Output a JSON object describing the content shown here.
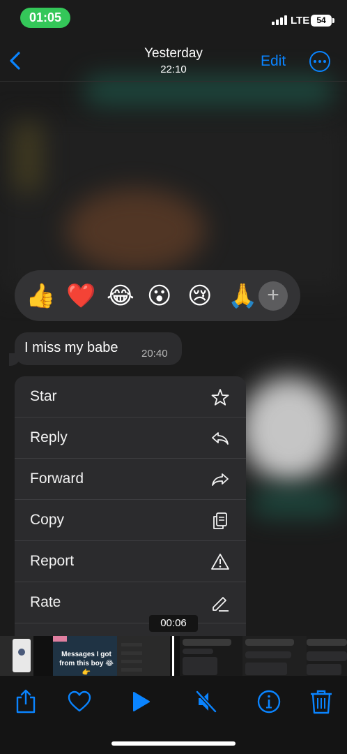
{
  "status_bar": {
    "time": "01:05",
    "network": "LTE",
    "battery": "54"
  },
  "nav": {
    "title": "Yesterday",
    "subtitle": "22:10",
    "edit_label": "Edit",
    "back_icon": "chevron-left-icon",
    "more_icon": "ellipsis-circle-icon"
  },
  "reactions": {
    "emojis": [
      "👍",
      "❤️",
      "😂",
      "😮",
      "😢",
      "🙏"
    ],
    "plus": "+"
  },
  "message": {
    "text": "I miss my babe",
    "time": "20:40"
  },
  "menu": {
    "items": [
      {
        "label": "Star",
        "icon": "star-icon"
      },
      {
        "label": "Reply",
        "icon": "reply-icon"
      },
      {
        "label": "Forward",
        "icon": "forward-icon"
      },
      {
        "label": "Copy",
        "icon": "copy-icon"
      },
      {
        "label": "Report",
        "icon": "warning-icon"
      },
      {
        "label": "Rate",
        "icon": "pencil-icon"
      }
    ]
  },
  "video": {
    "timestamp": "00:06"
  },
  "filmstrip": {
    "caption": "Messages I got from this boy 😂👉"
  },
  "toolbar": {
    "icons": [
      "share-icon",
      "heart-icon",
      "play-icon",
      "mute-icon",
      "info-icon",
      "trash-icon"
    ]
  },
  "colors": {
    "accent": "#0a84ff",
    "status_pill": "#34c759",
    "menu_bg": "#2b2b2d",
    "reaction_bg": "#333335"
  }
}
